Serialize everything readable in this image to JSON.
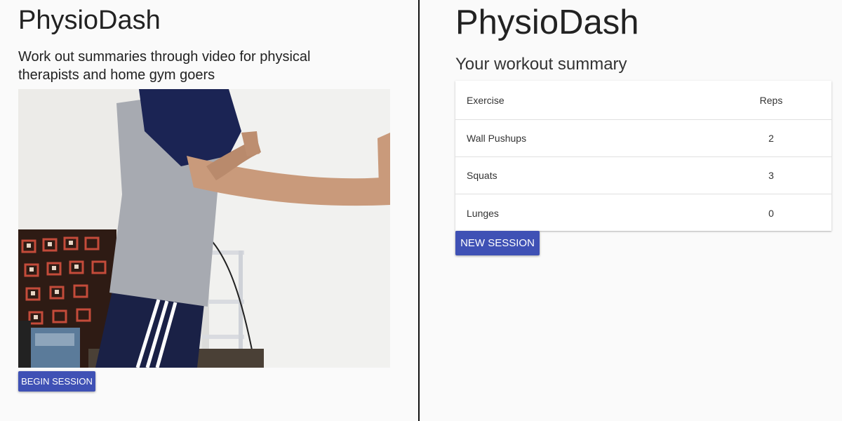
{
  "left": {
    "title": "PhysioDash",
    "subtitle": "Work out summaries through video for physical therapists and home gym goers",
    "video_alt": "Person doing wall pushups against a white wall",
    "begin_button": "BEGIN SESSION"
  },
  "right": {
    "title": "PhysioDash",
    "subtitle": "Your workout summary",
    "table": {
      "headers": {
        "exercise": "Exercise",
        "reps": "Reps"
      },
      "rows": [
        {
          "exercise": "Wall Pushups",
          "reps": "2"
        },
        {
          "exercise": "Squats",
          "reps": "3"
        },
        {
          "exercise": "Lunges",
          "reps": "0"
        }
      ]
    },
    "new_button": "NEW SESSION"
  },
  "colors": {
    "accent": "#3f51b5",
    "background": "#fafafa",
    "divider": "#111111"
  }
}
